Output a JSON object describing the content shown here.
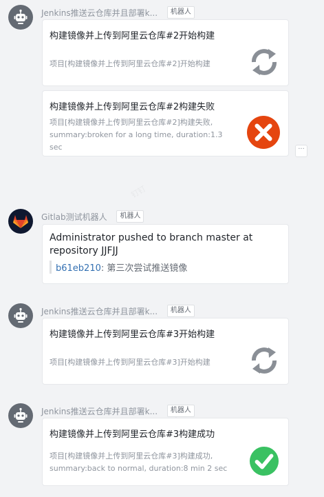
{
  "messages": [
    {
      "sender": "Jenkins推送云仓库并且部署k...",
      "tag": "机器人",
      "cards": [
        {
          "title": "构建镜像并上传到阿里云仓库#2开始构建",
          "body": "项目[构建镜像并上传到阿里云仓库#2]开始构建",
          "icon": "refresh-icon"
        },
        {
          "title": "构建镜像并上传到阿里云仓库#2构建失败",
          "body": "项目[构建镜像并上传到阿里云仓库#2]构建失败, summary:broken for a long time, duration:1.3 sec",
          "icon": "fail-x-icon"
        }
      ]
    },
    {
      "sender": "Gitlab测试机器人",
      "tag": "机器人",
      "title": "Administrator pushed to branch master at repository JJFJJ",
      "commit_hash": "b61eb210",
      "commit_separator": ":",
      "commit_message": "第三次尝试推送镜像"
    },
    {
      "sender": "Jenkins推送云仓库并且部署k...",
      "tag": "机器人",
      "card": {
        "title": "构建镜像并上传到阿里云仓库#3开始构建",
        "body": "项目[构建镜像并上传到阿里云仓库#3]开始构建",
        "icon": "refresh-icon"
      }
    },
    {
      "sender": "Jenkins推送云仓库并且部署k...",
      "tag": "机器人",
      "card": {
        "title": "构建镜像并上传到阿里云仓库#3构建成功",
        "body": "项目[构建镜像并上传到阿里云仓库#3]构建成功, summary:back to normal, duration:8 min 2 sec",
        "icon": "success-check-icon"
      }
    }
  ],
  "more_button": "···",
  "colors": {
    "fail": "#e5450f",
    "success": "#3ac162",
    "refresh": "#8a8f96",
    "link": "#3370b2"
  }
}
